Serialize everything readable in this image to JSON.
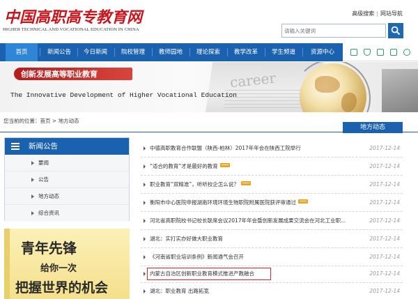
{
  "header": {
    "logo_cn": "中国高职高专教育网",
    "logo_en": "HIGHER TECHNICAL AND VOCATIONAL EDUCATION IN CHINA",
    "links": [
      "高级搜索",
      "网站导航"
    ],
    "search_placeholder": "请输入关键词",
    "icons": {
      "search": "search-icon"
    }
  },
  "nav": {
    "items": [
      "首页",
      "新闻公告",
      "今日新闻",
      "院校管理",
      "教师园地",
      "理论探索",
      "教学改革",
      "学生频道",
      "资源中心"
    ],
    "active_index": 0,
    "tool_icons": [
      "grid-icon",
      "shield-icon",
      "copy-icon",
      "image-icon",
      "gear-icon"
    ]
  },
  "banner": {
    "title_cn": "创新发展高等职业教育",
    "title_en": "The Innovative Development of Higher Vocational Education",
    "paper_word": "career"
  },
  "breadcrumb": {
    "prefix": "您当前的位置：",
    "home": "首页",
    "separator": ">",
    "current": "地方动态"
  },
  "section_title": "地方动态",
  "sidebar": {
    "title": "新闻公告",
    "items": [
      "要闻",
      "公告",
      "地方动态",
      "综合资讯"
    ]
  },
  "ad": {
    "line1": "青年先锋",
    "line2": "给你一次",
    "line3": "把握世界的机会"
  },
  "news": [
    {
      "title": "中德高职教育合作联盟（陕西-柏林）2017年年会在陕西工院举行",
      "date": "2017-12-14",
      "is_new": false
    },
    {
      "title": "“适合的教育”才是最好的教育",
      "date": "2017-12-14",
      "is_new": true
    },
    {
      "title": "职业教育“双精准”，听听校企怎么说？",
      "date": "2017-12-14",
      "is_new": true
    },
    {
      "title": "衡阳市中心医院申报湖南环境环境生物职院附属医院获评审通过",
      "date": "2017-12-14",
      "is_new": true
    },
    {
      "title": "河北省高职院校书记校长联席会议2017年年会暨创新发展成果交流会在河北工业职...",
      "date": "2017-12-14",
      "is_new": false
    },
    {
      "title": "湖北：实打实办好做大职业教育",
      "date": "2017-12-14",
      "is_new": false
    },
    {
      "title": "《河南省职业培训条例》新闻通气会召开",
      "date": "2017-12-14",
      "is_new": false
    },
    {
      "title": "内蒙古自治区创新职业教育模式推进产教融合",
      "date": "2017-12-14",
      "is_new": false
    },
    {
      "title": "湖北：职业教育 出路拓宽",
      "date": "2017-12-14",
      "is_new": false
    }
  ],
  "highlighted_index": 7,
  "colors": {
    "brand_blue": "#1a62b0",
    "logo_red": "#c8161d",
    "highlight_red": "#e32222",
    "new_tag": "#f1a11e"
  }
}
